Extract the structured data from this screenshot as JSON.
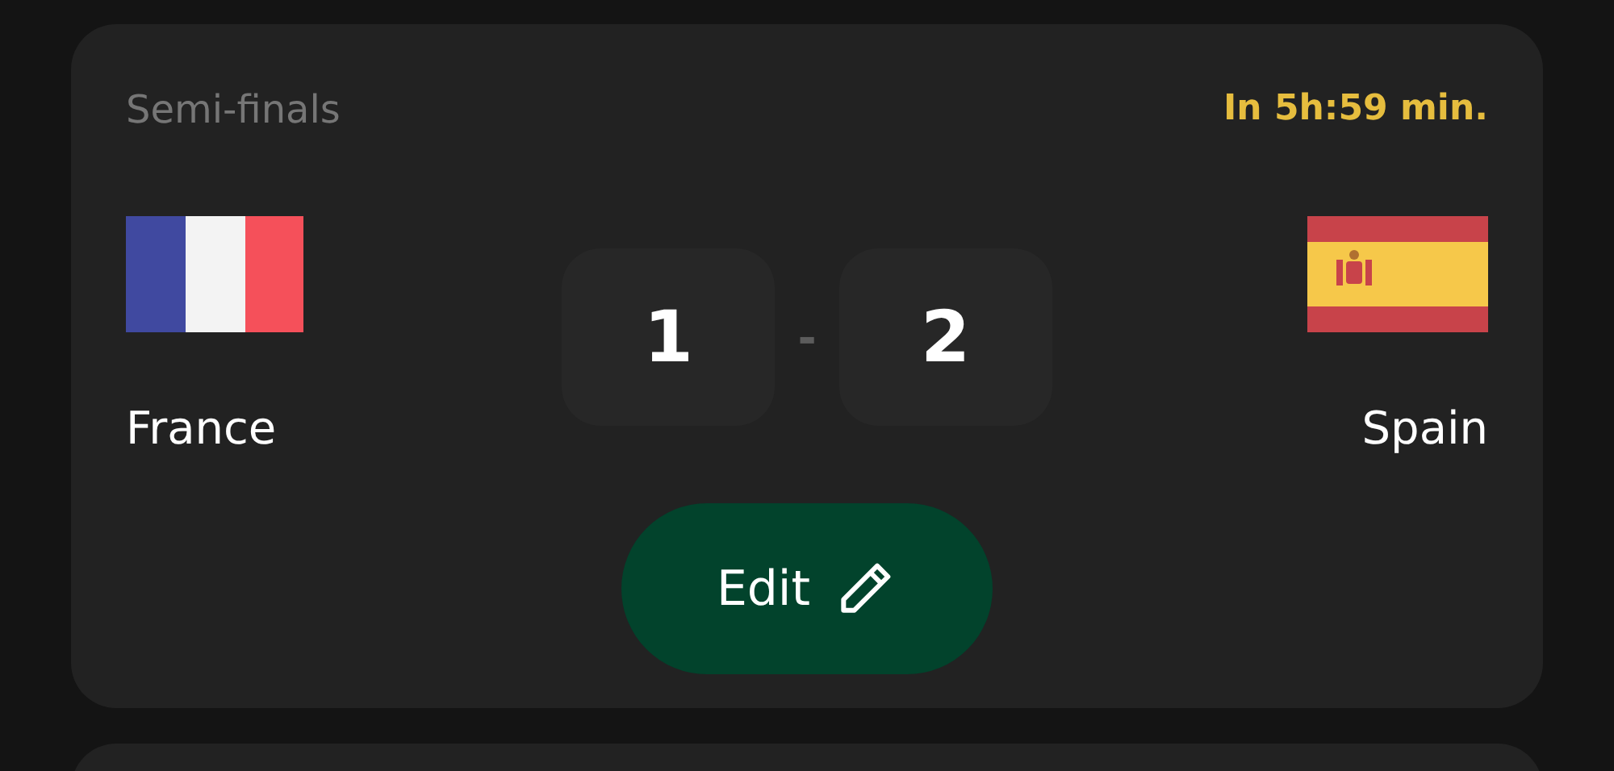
{
  "match": {
    "stage": "Semi-finals",
    "countdown": "In 5h:59 min.",
    "home": {
      "name": "France",
      "score": "1"
    },
    "away": {
      "name": "Spain",
      "score": "2"
    },
    "separator": "-",
    "edit_button": {
      "label": "Edit"
    }
  }
}
